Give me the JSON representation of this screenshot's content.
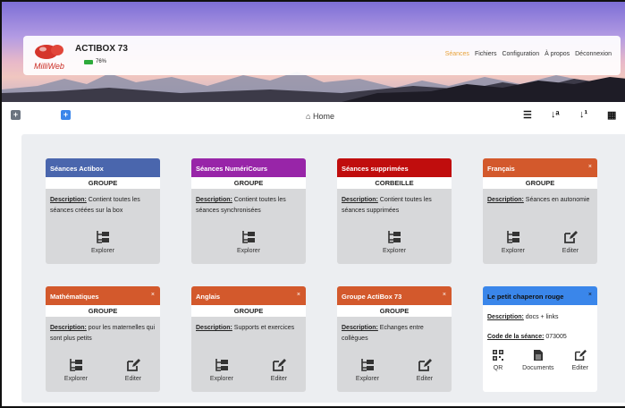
{
  "header": {
    "app_title": "ACTIBOX 73",
    "battery": "76%",
    "logo_text": "MilliWeb",
    "nav": [
      "Séances",
      "Fichiers",
      "Configuration",
      "À propos",
      "Déconnexion"
    ]
  },
  "toolbar": {
    "home": "Home"
  },
  "cards": [
    {
      "title": "Séances Actibox",
      "color": "#4a66ad",
      "group": "GROUPE",
      "desc_label": "Description:",
      "desc": " Contient toutes les séances créées sur la box",
      "actions": [
        "Explorer"
      ],
      "close": ""
    },
    {
      "title": "Séances NumériCours",
      "color": "#9825a8",
      "group": "GROUPE",
      "desc_label": "Description:",
      "desc": " Contient toutes les séances synchronisées",
      "actions": [
        "Explorer"
      ],
      "close": ""
    },
    {
      "title": "Séances supprimées",
      "color": "#c00d0d",
      "group": "CORBEILLE",
      "desc_label": "Description:",
      "desc": " Contient toutes les séances supprimées",
      "actions": [
        "Explorer"
      ],
      "close": ""
    },
    {
      "title": "Français",
      "color": "#d3592c",
      "group": "GROUPE",
      "desc_label": "Description:",
      "desc": " Séances en autonomie",
      "actions": [
        "Explorer",
        "Editer"
      ],
      "close": "×"
    },
    {
      "title": "Mathématiques",
      "color": "#d3592c",
      "group": "GROUPE",
      "desc_label": "Description:",
      "desc": " pour les maternelles qui sont plus petits",
      "actions": [
        "Explorer",
        "Editer"
      ],
      "close": "×"
    },
    {
      "title": "Anglais",
      "color": "#d3592c",
      "group": "GROUPE",
      "desc_label": "Description:",
      "desc": " Supports et exercices",
      "actions": [
        "Explorer",
        "Editer"
      ],
      "close": "×"
    },
    {
      "title": "Groupe ActiBox 73",
      "color": "#d3592c",
      "group": "GROUPE",
      "desc_label": "Description:",
      "desc": " Echanges entre collègues",
      "actions": [
        "Explorer",
        "Editer"
      ],
      "close": "×"
    }
  ],
  "session_card": {
    "title": "Le petit chaperon rouge",
    "color": "#3a86ea",
    "close": "×",
    "desc_label": "Description:",
    "desc": " docs + links",
    "code_label": "Code de la séance:",
    "code": " 073005",
    "actions": [
      "QR",
      "Documents",
      "Editer"
    ]
  }
}
